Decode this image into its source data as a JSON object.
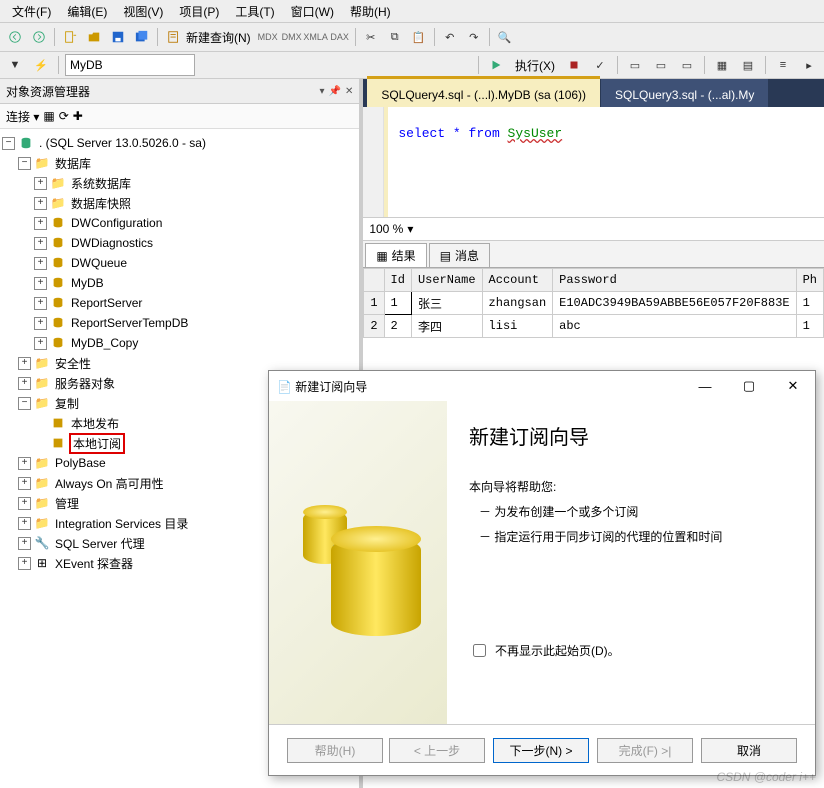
{
  "menubar": [
    "文件(F)",
    "编辑(E)",
    "视图(V)",
    "项目(P)",
    "工具(T)",
    "窗口(W)",
    "帮助(H)"
  ],
  "toolbar": {
    "new_query": "新建查询(N)"
  },
  "toolbar2": {
    "db": "MyDB",
    "exec": "执行(X)"
  },
  "object_explorer": {
    "title": "对象资源管理器",
    "connect": "连接 ▾",
    "root": ". (SQL Server 13.0.5026.0 - sa)",
    "nodes": {
      "db": "数据库",
      "sysdb": "系统数据库",
      "dbsnap": "数据库快照",
      "dblist": [
        "DWConfiguration",
        "DWDiagnostics",
        "DWQueue",
        "MyDB",
        "ReportServer",
        "ReportServerTempDB",
        "MyDB_Copy"
      ],
      "security": "安全性",
      "server_obj": "服务器对象",
      "replication": "复制",
      "publication": "本地发布",
      "subscription": "本地订阅",
      "polybase": "PolyBase",
      "alwayson": "Always On 高可用性",
      "mgmt": "管理",
      "integ": "Integration Services 目录",
      "agent": "SQL Server 代理",
      "xevent": "XEvent 探查器"
    }
  },
  "tabs": {
    "active": "SQLQuery4.sql - (...l).MyDB (sa (106))",
    "inactive": "SQLQuery3.sql - (...al).My"
  },
  "editor": {
    "code_pre": "select * from ",
    "table": "SysUser"
  },
  "zoom": "100 %",
  "results": {
    "tab1": "结果",
    "tab2": "消息",
    "cols": [
      "",
      "Id",
      "UserName",
      "Account",
      "Password",
      "Ph"
    ],
    "rows": [
      {
        "n": "1",
        "id": "1",
        "user": "张三",
        "acc": "zhangsan",
        "pw": "E10ADC3949BA59ABBE56E057F20F883E",
        "ph": "1"
      },
      {
        "n": "2",
        "id": "2",
        "user": "李四",
        "acc": "lisi",
        "pw": "abc",
        "ph": "1"
      }
    ]
  },
  "dialog": {
    "title": "新建订阅向导",
    "heading": "新建订阅向导",
    "intro": "本向导将帮助您:",
    "b1": "－ 为发布创建一个或多个订阅",
    "b2": "－ 指定运行用于同步订阅的代理的位置和时间",
    "check": "不再显示此起始页(D)。",
    "help": "帮助(H)",
    "back": "< 上一步",
    "next": "下一步(N) >",
    "finish": "完成(F) >|",
    "cancel": "取消"
  },
  "watermark": "CSDN @coder i++"
}
